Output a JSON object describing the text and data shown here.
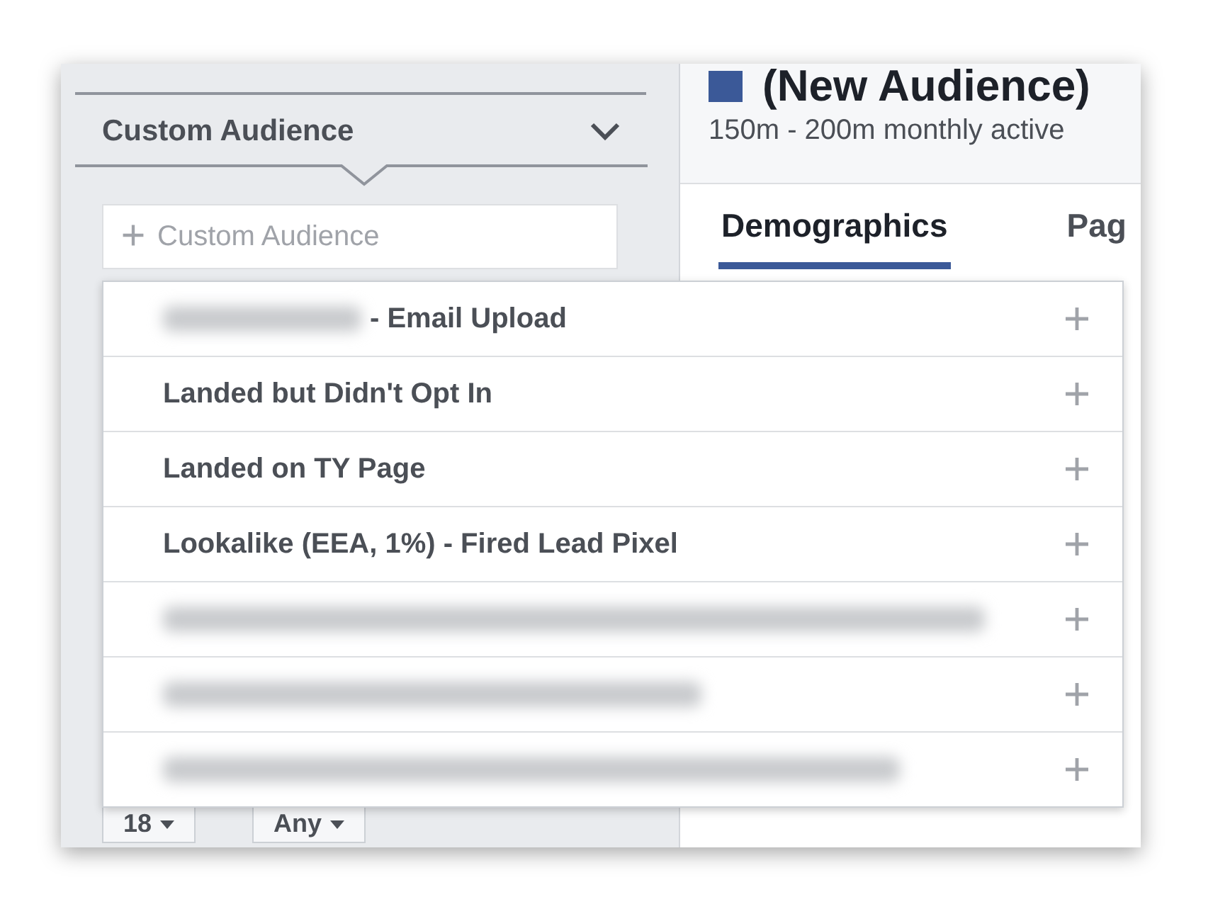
{
  "sidebar": {
    "section_title": "Custom Audience",
    "expanded": true,
    "search": {
      "placeholder": "Custom Audience"
    },
    "selects": [
      {
        "value": "18"
      },
      {
        "value": "Any"
      }
    ]
  },
  "dropdown": {
    "items": [
      {
        "kind": "partly_blurred",
        "label": "- Email Upload"
      },
      {
        "kind": "text",
        "label": "Landed but Didn't Opt In"
      },
      {
        "kind": "text",
        "label": "Landed on TY Page"
      },
      {
        "kind": "text",
        "label": "Lookalike (EEA, 1%) - Fired Lead Pixel"
      },
      {
        "kind": "blurred"
      },
      {
        "kind": "blurred"
      },
      {
        "kind": "blurred"
      }
    ]
  },
  "audience": {
    "title": "(New Audience)",
    "color": "#3b5998",
    "subtitle": "150m - 200m monthly active"
  },
  "tabs": [
    {
      "label": "Demographics",
      "selected": true
    },
    {
      "label": "Pag",
      "selected": false
    }
  ]
}
